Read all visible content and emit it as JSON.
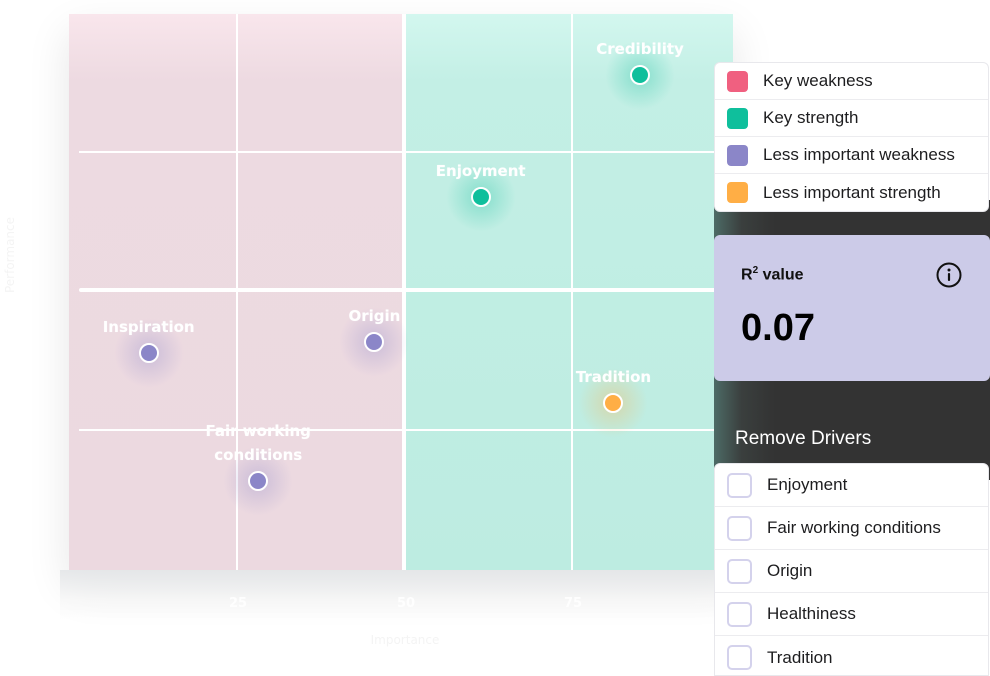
{
  "chart_data": {
    "type": "scatter",
    "title": "",
    "xlabel": "Importance",
    "ylabel": "Performance",
    "xlim": [
      0,
      100
    ],
    "ylim": [
      0,
      100
    ],
    "x_ticks": [
      "25",
      "50",
      "75"
    ],
    "y_ticks": [
      "",
      "",
      ""
    ],
    "grid": true,
    "legend_position": "right",
    "quadrant_colors": {
      "left": "#ecd9e0",
      "right": "#bdece1"
    },
    "categories": [
      {
        "name": "Key weakness",
        "color": "#f06080"
      },
      {
        "name": "Key strength",
        "color": "#0fbf9c"
      },
      {
        "name": "Less important weakness",
        "color": "#8b86c8"
      },
      {
        "name": "Less important strength",
        "color": "#ffae45"
      }
    ],
    "points": [
      {
        "label": "Credibility",
        "x": 86,
        "y": 89,
        "category": "Key strength"
      },
      {
        "label": "Enjoyment",
        "x": 62,
        "y": 67,
        "category": "Key strength"
      },
      {
        "label": "Inspiration",
        "x": 12,
        "y": 39,
        "category": "Less important weakness"
      },
      {
        "label": "Origin",
        "x": 46,
        "y": 41,
        "category": "Less important weakness"
      },
      {
        "label": "Fair working\nconditions",
        "x": 28.5,
        "y": 16,
        "category": "Less important weakness"
      },
      {
        "label": "Tradition",
        "x": 82,
        "y": 30,
        "category": "Less important strength"
      }
    ]
  },
  "legend": {
    "items": [
      {
        "label": "Key weakness",
        "color": "#f06080"
      },
      {
        "label": "Key strength",
        "color": "#0fbf9c"
      },
      {
        "label": "Less important weakness",
        "color": "#8b86c8"
      },
      {
        "label": "Less important strength",
        "color": "#ffae45"
      }
    ]
  },
  "r2": {
    "title_main": "R",
    "title_sup": "2",
    "title_rest": " value",
    "value": "0.07",
    "info_icon": "info-icon"
  },
  "remove_drivers": {
    "title": "Remove Drivers",
    "items": [
      {
        "label": "Enjoyment",
        "checked": false
      },
      {
        "label": "Fair working conditions",
        "checked": false
      },
      {
        "label": "Origin",
        "checked": false
      },
      {
        "label": "Healthiness",
        "checked": false
      },
      {
        "label": "Tradition",
        "checked": false
      }
    ]
  }
}
